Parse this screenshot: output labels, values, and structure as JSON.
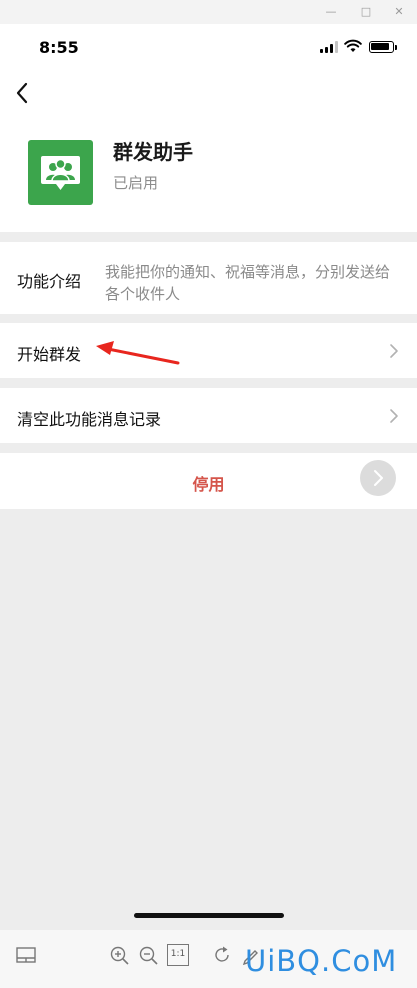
{
  "status_bar": {
    "time": "8:55"
  },
  "app": {
    "title": "群发助手",
    "status": "已启用"
  },
  "intro": {
    "label": "功能介绍",
    "description": "我能把你的通知、祝福等消息，分别发送给各个收件人"
  },
  "menu": [
    {
      "label": "开始群发"
    },
    {
      "label": "清空此功能消息记录"
    }
  ],
  "disable_button": {
    "label": "停用"
  },
  "toolbar": {
    "actual_size_label": "1:1"
  },
  "watermark": {
    "text": "UiBQ.CoM"
  },
  "colors": {
    "icon_green": "#3ca54c",
    "danger_red": "#d5554b",
    "arrow_red": "#e8261e",
    "watermark_blue": "#2f8ee0"
  }
}
